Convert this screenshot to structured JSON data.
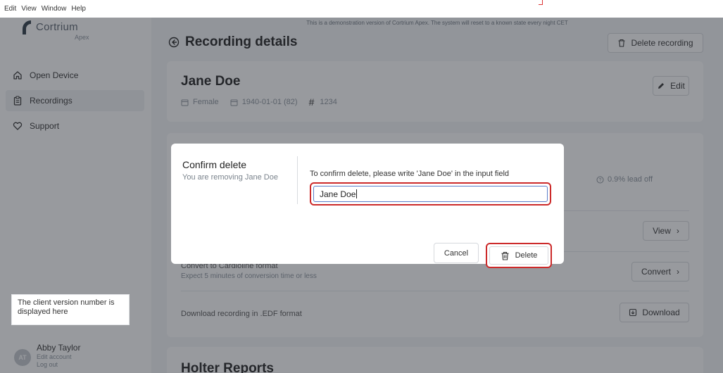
{
  "menubar": {
    "items": [
      "Edit",
      "View",
      "Window",
      "Help"
    ]
  },
  "sidebar": {
    "logo_name": "Cortrium",
    "logo_sub": "Apex",
    "items": [
      {
        "label": "Open Device",
        "icon": "home-icon"
      },
      {
        "label": "Recordings",
        "icon": "clipboard-icon"
      },
      {
        "label": "Support",
        "icon": "heart-icon"
      }
    ],
    "tooltip": "The client version number is displayed here",
    "user": {
      "initials": "AT",
      "name": "Abby Taylor",
      "edit": "Edit account",
      "logout": "Log out"
    }
  },
  "banner": "This is a demonstration version of Cortrium Apex. The system will reset to a known state every night CET",
  "page": {
    "title": "Recording details",
    "delete_recording": "Delete recording"
  },
  "patient": {
    "name": "Jane Doe",
    "gender": "Female",
    "dob": "1940-01-01 (82)",
    "id": "1234",
    "edit": "Edit"
  },
  "recording": {
    "lead_off": "0.9% lead off",
    "view": "View",
    "convert_title": "Convert to Cardioline format",
    "convert_sub": "Expect 5 minutes of conversion time or less",
    "convert": "Convert",
    "download_title": "Download recording in .EDF format",
    "download": "Download"
  },
  "holter": {
    "title": "Holter Reports"
  },
  "modal": {
    "title": "Confirm delete",
    "subtitle": "You are removing Jane Doe",
    "label": "To confirm delete, please write 'Jane Doe' in the input field",
    "input_value": "Jane Doe",
    "cancel": "Cancel",
    "delete": "Delete"
  },
  "colors": {
    "danger_outline": "#cc2a2a",
    "sidebar_bg": "#ffffff",
    "page_bg": "#f4f5f7"
  }
}
